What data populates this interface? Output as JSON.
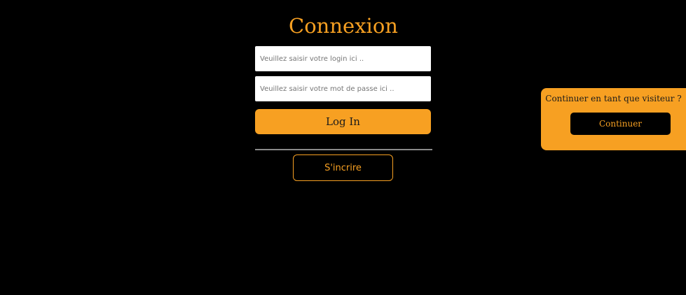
{
  "login_form": {
    "title": "Connexion",
    "login_placeholder": "Veuillez saisir votre login ici ..",
    "password_placeholder": "Veuillez saisir votre mot de passe ici ..",
    "login_button": "Log In",
    "signup_button": "S'incrire"
  },
  "visitor_panel": {
    "prompt": "Continuer en tant que visiteur ?",
    "continue_button": "Continuer"
  },
  "colors": {
    "accent": "#f7a022",
    "background": "#000000",
    "divider": "#8a8a8a"
  }
}
